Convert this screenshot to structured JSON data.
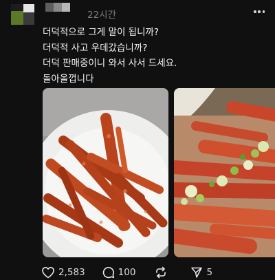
{
  "post": {
    "timestamp": "22시간",
    "lines": [
      "더덕적으로 그게 말이 됩니까?",
      "더덕적 사고 우데갔습니까?",
      "더덕 판매중이니 와서 사서 드세요.",
      "돌아올껍니다"
    ]
  },
  "media": [
    {
      "description": "seasoned deodeok on a white plate"
    },
    {
      "description": "seasoned deodeok with green onions"
    }
  ],
  "actions": {
    "likes": "2,583",
    "replies": "100",
    "reposts": "",
    "shares": "5"
  },
  "icons": [
    "more-icon",
    "heart-icon",
    "reply-icon",
    "repost-icon",
    "share-icon"
  ],
  "colors": {
    "background": "#101010",
    "text": "#f3f5f7",
    "muted": "#7d7d7d"
  }
}
